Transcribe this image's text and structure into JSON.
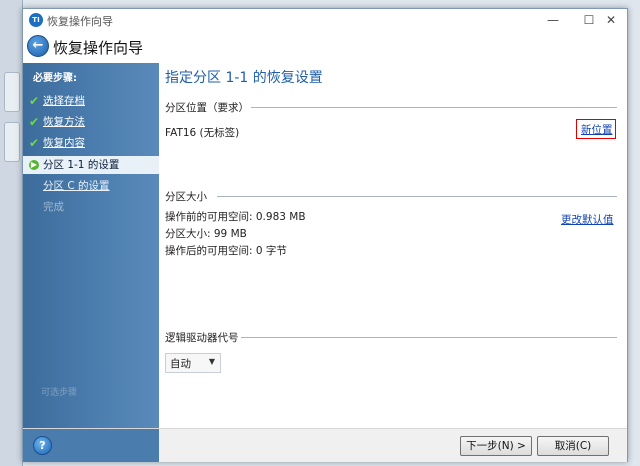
{
  "window": {
    "title": "恢复操作向导",
    "controls": {
      "minimize": "—",
      "maximize": "☐",
      "close": "✕"
    }
  },
  "header": {
    "title": "恢复操作向导"
  },
  "sidebar": {
    "steps_label": "必要步骤:",
    "steps": [
      {
        "label": "选择存档",
        "state": "done"
      },
      {
        "label": "恢复方法",
        "state": "done"
      },
      {
        "label": "恢复内容",
        "state": "done"
      },
      {
        "label": "分区 1-1  的设置",
        "state": "current"
      },
      {
        "label": "分区 C  的设置",
        "state": "pending"
      },
      {
        "label": "完成",
        "state": "disabled"
      }
    ],
    "faded_text": "可选步骤"
  },
  "main": {
    "title": "指定分区 1-1  的恢复设置",
    "location": {
      "heading": "分区位置（要求）",
      "value": "FAT16 (无标签)",
      "new_location_link": "新位置"
    },
    "size": {
      "heading": "分区大小",
      "free_before": "操作前的可用空间:  0.983 MB",
      "partition_size": "分区大小: 99 MB",
      "free_after": "操作后的可用空间:  0 字节",
      "change_default_link": "更改默认值"
    },
    "drive_letter": {
      "heading": "逻辑驱动器代号",
      "selected": "自动"
    }
  },
  "footer": {
    "next_button": "下一步(N) >",
    "cancel_button": "取消(C)"
  },
  "colors": {
    "sidebar": "#4a7cae",
    "title_blue": "#1f5fa8",
    "link": "#1245b4",
    "check_green": "#6ddc3c",
    "highlight_box": "#e00000"
  }
}
